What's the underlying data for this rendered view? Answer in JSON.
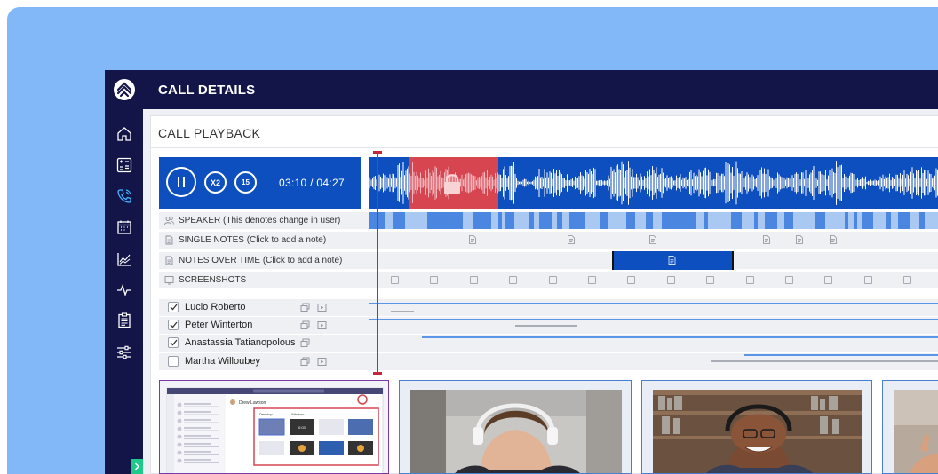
{
  "app": {
    "title": "CALL DETAILS",
    "section_title": "CALL PLAYBACK"
  },
  "sidebar": {
    "items": [
      {
        "icon": "home-icon"
      },
      {
        "icon": "calculator-icon"
      },
      {
        "icon": "phone-icon"
      },
      {
        "icon": "calendar-icon"
      },
      {
        "icon": "line-chart-icon"
      },
      {
        "icon": "pulse-icon"
      },
      {
        "icon": "clipboard-icon"
      },
      {
        "icon": "sliders-icon"
      }
    ]
  },
  "player": {
    "speed_label": "X2",
    "skip_label": "15",
    "time": "03:10  /  04:27",
    "progress": 0.712
  },
  "tracks": {
    "speaker": {
      "label": "SPEAKER",
      "hint": "(This denotes change in user)"
    },
    "single_notes": {
      "label": "SINGLE NOTES",
      "hint": "(Click to add a note)"
    },
    "notes_over_time": {
      "label": "NOTES OVER TIME",
      "hint": "(Click to add a note)"
    },
    "screenshots": {
      "label": "SCREENSHOTS"
    }
  },
  "participants": [
    {
      "name": "Lucio Roberto",
      "checked": true
    },
    {
      "name": "Peter Winterton",
      "checked": true
    },
    {
      "name": "Anastassia Tatianopolous",
      "checked": true
    },
    {
      "name": "Martha Willoubey",
      "checked": false
    }
  ],
  "thumbnail": {
    "user_name": "Drew Lawson",
    "tab1": "Desktop",
    "tab2": "Window",
    "timer": "0:03"
  },
  "colors": {
    "brand_navy": "#131549",
    "player_blue": "#0d4fbe",
    "accent_green": "#1ec98a",
    "redacted_red": "#d64550",
    "playhead": "#c0283c",
    "background": "#82b8f8"
  }
}
